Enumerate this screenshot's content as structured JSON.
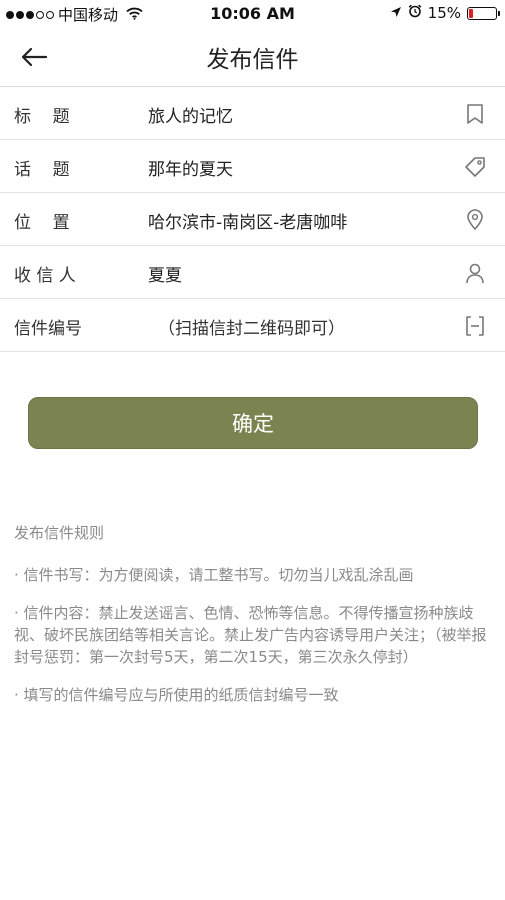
{
  "status_bar": {
    "carrier": "中国移动",
    "time": "10:06 AM",
    "battery_percent_text": "15%",
    "battery_level": 0.15,
    "battery_color": "#e0201a"
  },
  "nav": {
    "title": "发布信件",
    "back_icon": "arrow-left-icon"
  },
  "form": {
    "rows": [
      {
        "label": "标    题",
        "value": "旅人的记忆",
        "icon": "bookmark-icon"
      },
      {
        "label": "话    题",
        "value": "那年的夏天",
        "icon": "tag-icon"
      },
      {
        "label": "位    置",
        "value": "哈尔滨市-南岗区-老唐咖啡",
        "icon": "location-pin-icon"
      },
      {
        "label": "收 信 人",
        "value": "夏夏",
        "icon": "person-icon"
      },
      {
        "label": "信件编号",
        "value": "（扫描信封二维码即可）",
        "icon": "scan-icon"
      }
    ]
  },
  "confirm": {
    "label": "确定",
    "color": "#7b8350"
  },
  "rules": {
    "title": "发布信件规则",
    "items": [
      "· 信件书写：为方便阅读，请工整书写。切勿当儿戏乱涂乱画",
      "· 信件内容：禁止发送谣言、色情、恐怖等信息。不得传播宣扬种族歧视、破坏民族团结等相关言论。禁止发广告内容诱导用户关注；（被举报封号惩罚：第一次封号5天，第二次15天，第三次永久停封）",
      "· 填写的信件编号应与所使用的纸质信封编号一致"
    ]
  }
}
